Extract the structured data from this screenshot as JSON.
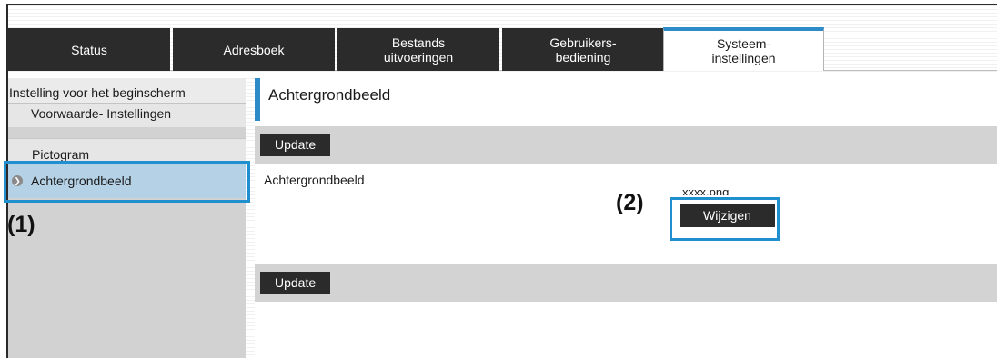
{
  "tabs": [
    {
      "line1": "Status",
      "line2": ""
    },
    {
      "line1": "Adresboek",
      "line2": ""
    },
    {
      "line1": "Bestands",
      "line2": "uitvoeringen"
    },
    {
      "line1": "Gebruikers-",
      "line2": "bediening"
    },
    {
      "line1": "Systeem-",
      "line2": "instellingen"
    }
  ],
  "sidebar": {
    "header": "Instelling voor het beginscherm",
    "items": [
      {
        "label": "Voorwaarde- Instellingen"
      },
      {
        "label": "Pictogram"
      },
      {
        "label": "Achtergrondbeeld"
      }
    ]
  },
  "main": {
    "title": "Achtergrondbeeld",
    "update_label": "Update",
    "field_label": "Achtergrondbeeld",
    "file_name": "xxxx.png",
    "change_label": "Wijzigen"
  },
  "callouts": {
    "one": "(1)",
    "two": "(2)"
  },
  "colors": {
    "accent": "#2e8bc9",
    "highlight": "#1f8fd0",
    "active_item": "#b4d1e6",
    "tab_dark": "#2b2b2b"
  }
}
